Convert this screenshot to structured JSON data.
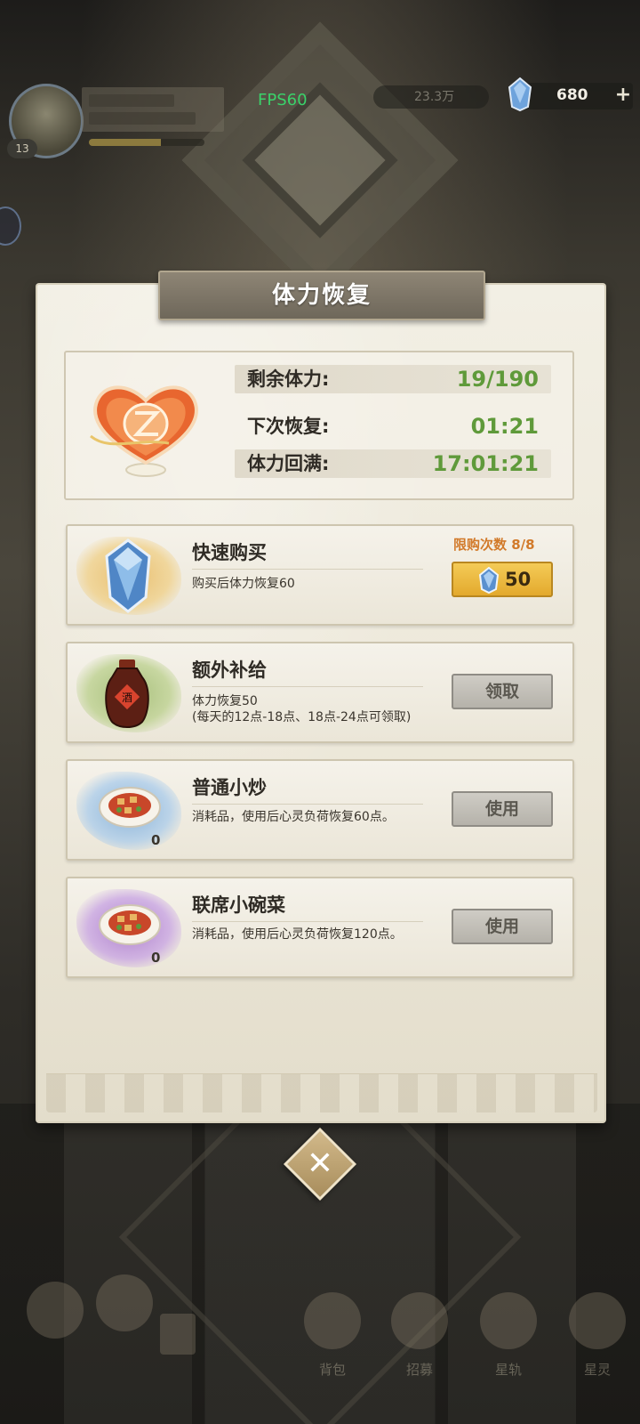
{
  "hud": {
    "fps": "FPS60",
    "gold": "23.3万",
    "gems": "680",
    "plus": "+",
    "level": "13"
  },
  "dialog": {
    "title": "体力恢复",
    "stamina": {
      "remaining_label": "剩余体力:",
      "remaining_value": "19/190",
      "next_label": "下次恢复:",
      "next_value": "01:21",
      "full_label": "体力回满:",
      "full_value": "17:01:21"
    },
    "items": [
      {
        "title": "快速购买",
        "desc": "购买后体力恢复60",
        "limit": "限购次数 8/8",
        "price": "50",
        "icon": "gem-icon"
      },
      {
        "title": "额外补给",
        "desc_line1": "体力恢复50",
        "desc_line2": "(每天的12点-18点、18点-24点可领取)",
        "button": "领取",
        "icon": "wine-jar-icon"
      },
      {
        "title": "普通小炒",
        "desc": "消耗品，使用后心灵负荷恢复60点。",
        "count": "0",
        "button": "使用",
        "icon": "stir-fry-dish-icon"
      },
      {
        "title": "联席小碗菜",
        "desc": "消耗品，使用后心灵负荷恢复120点。",
        "count": "0",
        "button": "使用",
        "icon": "small-bowl-dish-icon"
      }
    ],
    "close": "✕"
  },
  "bottom_nav": [
    "背包",
    "招募",
    "星轨",
    "星灵"
  ],
  "colors": {
    "stamina_value": "#5f9a3a",
    "limit_text": "#d27a2a",
    "gold_button": "#f4cb57",
    "fps_text": "#3ad26a"
  }
}
